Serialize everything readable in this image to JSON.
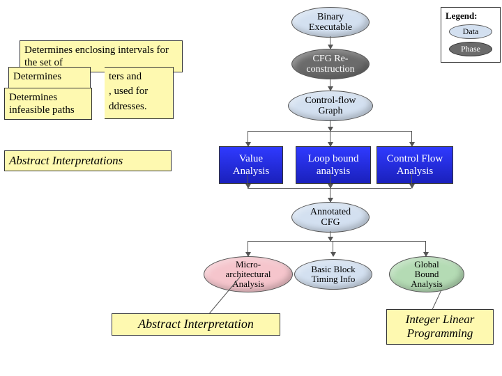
{
  "legend": {
    "title": "Legend:",
    "data": "Data",
    "phase": "Phase"
  },
  "nodes": {
    "binary": "Binary\nExecutable",
    "cfg_rec": "CFG Re-\nconstruction",
    "cfg": "Control-flow\nGraph",
    "annotated": "Annotated\nCFG",
    "micro": "Micro-\narchitectural\nAnalysis",
    "bbti": "Basic Block\nTiming Info",
    "global": "Global\nBound\nAnalysis"
  },
  "blue": {
    "value": "Value Analysis",
    "loop": "Loop bound analysis",
    "cfa": "Control Flow Analysis"
  },
  "yellow": {
    "enclosing": "Determines enclosing intervals for the set of",
    "det1a": "Determines",
    "det1b": "ters and",
    "det1c": ", used for",
    "det2a": "Determines infeasible paths",
    "det2b": "ddresses.",
    "absints": "Abstract Interpretations",
    "absint": "Abstract Interpretation",
    "ilp": "Integer Linear Programming"
  }
}
